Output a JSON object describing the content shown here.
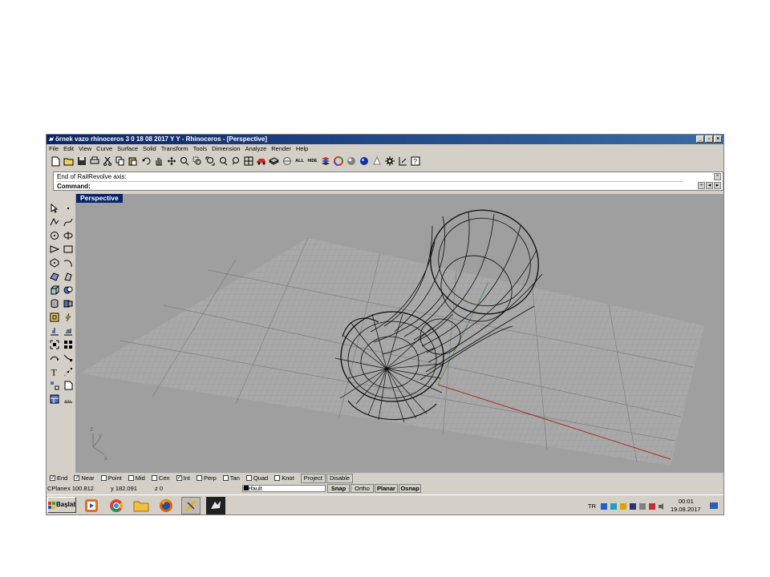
{
  "window": {
    "title": "örnek vazo rhinoceros 3 0 18 08 2017 Y Y - Rhinoceros - [Perspective]",
    "controls": [
      "_",
      "▫",
      "×"
    ]
  },
  "menu": [
    "File",
    "Edit",
    "View",
    "Curve",
    "Surface",
    "Solid",
    "Transform",
    "Tools",
    "Dimension",
    "Analyze",
    "Render",
    "Help"
  ],
  "toolbar": {
    "icons": [
      "new-file-icon",
      "open-folder-icon",
      "save-icon",
      "print-icon",
      "cut-icon",
      "copy-icon",
      "paste-icon",
      "undo-icon",
      "pan-hand-icon",
      "rotate-view-icon",
      "zoom-icon",
      "zoom-window-icon",
      "zoom-extents-icon",
      "zoom-selected-icon",
      "undo-view-icon",
      "four-viewports-icon",
      "car-icon",
      "layers-icon",
      "properties-icon",
      "zoom-all-icon",
      "hide-icon",
      "stack-icon",
      "color-wheel-icon",
      "sphere-icon",
      "blue-sphere-icon",
      "light-icon",
      "gear-icon",
      "dimension-icon",
      "help-icon"
    ],
    "all_label": "ALL",
    "hide_label": "HIDE"
  },
  "command": {
    "history": "End of RailRevolve axis:",
    "prompt": "Command:"
  },
  "viewport": {
    "tab": "Perspective"
  },
  "axis_labels": {
    "z": "z",
    "y": "y",
    "x": "x"
  },
  "osnaps": [
    {
      "label": "End",
      "checked": true
    },
    {
      "label": "Near",
      "checked": true
    },
    {
      "label": "Point",
      "checked": false
    },
    {
      "label": "Mid",
      "checked": false
    },
    {
      "label": "Cen",
      "checked": false
    },
    {
      "label": "Int",
      "checked": true
    },
    {
      "label": "Perp",
      "checked": false
    },
    {
      "label": "Tan",
      "checked": false
    },
    {
      "label": "Quad",
      "checked": false
    },
    {
      "label": "Knot",
      "checked": false
    }
  ],
  "osnap_buttons": {
    "project": "Project",
    "disable": "Disable"
  },
  "status": {
    "cplane": "CPlane",
    "x": "x 100.812",
    "y": "y 182.091",
    "z": "z 0",
    "layer": "Default",
    "snap": "Snap",
    "ortho": "Ortho",
    "planar": "Planar",
    "osnap": "Osnap"
  },
  "taskbar": {
    "start": "Başlat",
    "language": "TR",
    "time": "00:01",
    "date": "19.08.2017"
  },
  "colors": {
    "title_bar": "#0a246a",
    "viewport_bg": "#9f9f9f",
    "grid_plane": "#a9a9a9",
    "x_axis": "#a62b2b",
    "y_axis": "#3f8a3f"
  }
}
